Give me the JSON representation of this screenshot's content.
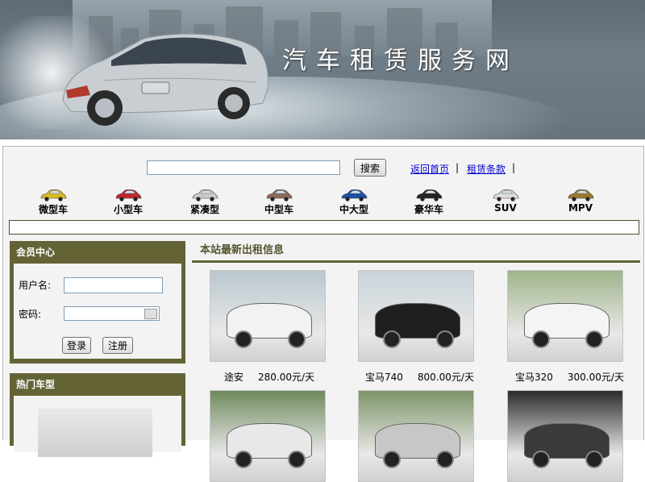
{
  "banner": {
    "title": "汽车租赁服务网"
  },
  "search": {
    "value": "",
    "button_label": "搜索"
  },
  "toplinks": [
    {
      "label": "返回首页"
    },
    {
      "label": "租赁条款"
    }
  ],
  "separator": "|",
  "categories": [
    {
      "label": "微型车",
      "color": "#d9b82a"
    },
    {
      "label": "小型车",
      "color": "#c0282b"
    },
    {
      "label": "紧凑型",
      "color": "#c9c9c9"
    },
    {
      "label": "中型车",
      "color": "#8a6a5a"
    },
    {
      "label": "中大型",
      "color": "#1c4fa8"
    },
    {
      "label": "豪华车",
      "color": "#222222"
    },
    {
      "label": "SUV",
      "color": "#dcdcdc"
    },
    {
      "label": "MPV",
      "color": "#9c7a2e"
    }
  ],
  "member": {
    "title": "会员中心",
    "username_label": "用户名:",
    "password_label": "密码:",
    "login_label": "登录",
    "register_label": "注册"
  },
  "hot": {
    "title": "热门车型"
  },
  "listing": {
    "title": "本站最新出租信息",
    "items": [
      {
        "name": "途安",
        "price": "280.00元/天",
        "car_color": "#f2f2f2",
        "bg": "#b9c7cf"
      },
      {
        "name": "宝马740",
        "price": "800.00元/天",
        "car_color": "#1f1f1f",
        "bg": "#c9d4da"
      },
      {
        "name": "宝马320",
        "price": "300.00元/天",
        "car_color": "#f4f4f4",
        "bg": "#9fb48a"
      },
      {
        "name": "",
        "price": "",
        "car_color": "#e8e8e8",
        "bg": "#6f8a5e"
      },
      {
        "name": "",
        "price": "",
        "car_color": "#c7c7c7",
        "bg": "#7d9468"
      },
      {
        "name": "",
        "price": "",
        "car_color": "#3a3a3a",
        "bg": "#2b2b2b"
      }
    ]
  },
  "colors": {
    "panel": "#636336",
    "link": "#0000cc",
    "page_bg": "#f3f3f3"
  }
}
